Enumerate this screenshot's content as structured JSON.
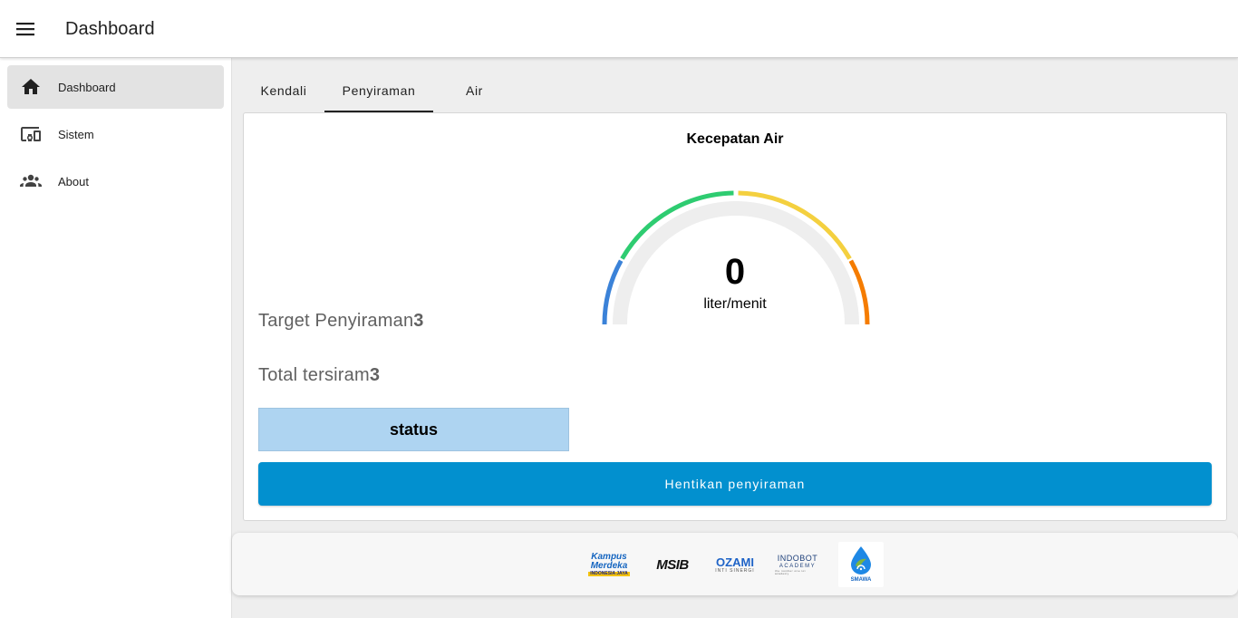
{
  "app": {
    "title": "Dashboard",
    "menu_icon": "menu-icon"
  },
  "sidebar": {
    "items": [
      {
        "label": "Dashboard",
        "icon": "home-icon",
        "active": true
      },
      {
        "label": "Sistem",
        "icon": "devices-icon",
        "active": false
      },
      {
        "label": "About",
        "icon": "people-icon",
        "active": false
      }
    ]
  },
  "tabs": [
    {
      "label": "Kendali",
      "active": false
    },
    {
      "label": "Penyiraman",
      "active": true
    },
    {
      "label": "Air",
      "active": false
    }
  ],
  "gauge": {
    "title": "Kecepatan Air",
    "value": "0",
    "unit": "liter/menit",
    "colors": [
      "#3b82d8",
      "#2ecc71",
      "#f4d03f",
      "#f57c00"
    ],
    "track_color": "#eeeeee"
  },
  "stats": {
    "target_label": "Target Penyiraman",
    "target_value": "3",
    "total_label": "Total tersiram",
    "total_value": "3"
  },
  "status": {
    "label": "status",
    "color": "#aed4f1"
  },
  "actions": {
    "stop_label": "Hentikan penyiraman",
    "stop_color": "#0290cf"
  },
  "footer": {
    "logos": [
      {
        "name": "kampus-merdeka-logo",
        "line1": "Kampus",
        "line2": "Merdeka",
        "sub": "INDONESIA JAYA"
      },
      {
        "name": "msib-logo",
        "line1": "MSIB"
      },
      {
        "name": "ozami-logo",
        "line1": "OZAMI",
        "sub": "INTI SINERGI"
      },
      {
        "name": "indobot-logo",
        "line1": "INDOBOT",
        "sub": "ACADEMY",
        "sub2": "the number one iot academy"
      },
      {
        "name": "smawa-logo",
        "line1": "SMAWA"
      }
    ]
  }
}
